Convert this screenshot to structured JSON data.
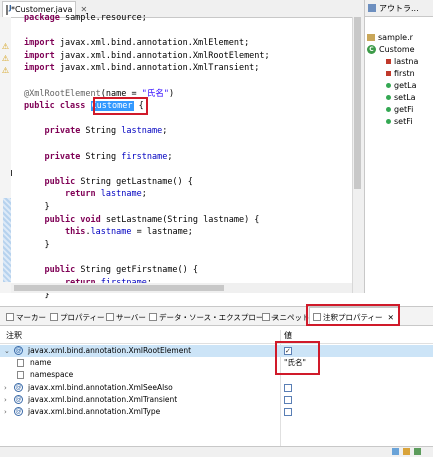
{
  "editor": {
    "tab_label": "*Customer.java",
    "tab_close": "✕",
    "lines": [
      {
        "parts": [
          {
            "c": "kw",
            "t": "package"
          },
          {
            "c": "",
            "t": " sample.resource;"
          }
        ]
      },
      {
        "parts": [
          {
            "c": "",
            "t": ""
          }
        ]
      },
      {
        "parts": [
          {
            "c": "kw",
            "t": "import"
          },
          {
            "c": "",
            "t": " javax.xml.bind.annotation.XmlElement;"
          }
        ]
      },
      {
        "parts": [
          {
            "c": "kw",
            "t": "import"
          },
          {
            "c": "",
            "t": " javax.xml.bind.annotation.XmlRootElement;"
          }
        ]
      },
      {
        "parts": [
          {
            "c": "kw",
            "t": "import"
          },
          {
            "c": "",
            "t": " javax.xml.bind.annotation.XmlTransient;"
          }
        ]
      },
      {
        "parts": [
          {
            "c": "",
            "t": ""
          }
        ]
      },
      {
        "parts": [
          {
            "c": "ann",
            "t": "@XmlRootElement"
          },
          {
            "c": "",
            "t": "(name = "
          },
          {
            "c": "str",
            "t": "\"氏名\""
          },
          {
            "c": "",
            "t": ")"
          }
        ]
      },
      {
        "parts": [
          {
            "c": "kw",
            "t": "public class"
          },
          {
            "c": "",
            "t": " "
          },
          {
            "c": "sel",
            "t": "Customer"
          },
          {
            "c": "",
            "t": " {"
          }
        ]
      },
      {
        "parts": [
          {
            "c": "",
            "t": ""
          }
        ]
      },
      {
        "parts": [
          {
            "c": "",
            "t": "    "
          },
          {
            "c": "kw",
            "t": "private"
          },
          {
            "c": "",
            "t": " String "
          },
          {
            "c": "fld",
            "t": "lastname"
          },
          {
            "c": "",
            "t": ";"
          }
        ]
      },
      {
        "parts": [
          {
            "c": "",
            "t": ""
          }
        ]
      },
      {
        "parts": [
          {
            "c": "",
            "t": "    "
          },
          {
            "c": "kw",
            "t": "private"
          },
          {
            "c": "",
            "t": " String "
          },
          {
            "c": "fld",
            "t": "firstname"
          },
          {
            "c": "",
            "t": ";"
          }
        ]
      },
      {
        "parts": [
          {
            "c": "",
            "t": ""
          }
        ]
      },
      {
        "parts": [
          {
            "c": "",
            "t": "    "
          },
          {
            "c": "kw",
            "t": "public"
          },
          {
            "c": "",
            "t": " String getLastname() {"
          }
        ]
      },
      {
        "parts": [
          {
            "c": "",
            "t": "        "
          },
          {
            "c": "kw",
            "t": "return"
          },
          {
            "c": "",
            "t": " "
          },
          {
            "c": "fld",
            "t": "lastname"
          },
          {
            "c": "",
            "t": ";"
          }
        ]
      },
      {
        "parts": [
          {
            "c": "",
            "t": "    }"
          }
        ]
      },
      {
        "parts": [
          {
            "c": "",
            "t": "    "
          },
          {
            "c": "kw",
            "t": "public void"
          },
          {
            "c": "",
            "t": " setLastname(String lastname) {"
          }
        ]
      },
      {
        "parts": [
          {
            "c": "",
            "t": "        "
          },
          {
            "c": "kw",
            "t": "this"
          },
          {
            "c": "",
            "t": "."
          },
          {
            "c": "fld",
            "t": "lastname"
          },
          {
            "c": "",
            "t": " = lastname;"
          }
        ]
      },
      {
        "parts": [
          {
            "c": "",
            "t": "    }"
          }
        ]
      },
      {
        "parts": [
          {
            "c": "",
            "t": ""
          }
        ]
      },
      {
        "parts": [
          {
            "c": "",
            "t": "    "
          },
          {
            "c": "kw",
            "t": "public"
          },
          {
            "c": "",
            "t": " String getFirstname() {"
          }
        ]
      },
      {
        "parts": [
          {
            "c": "",
            "t": "        "
          },
          {
            "c": "kw",
            "t": "return"
          },
          {
            "c": "",
            "t": " "
          },
          {
            "c": "fld",
            "t": "firstname"
          },
          {
            "c": "",
            "t": ";"
          }
        ]
      },
      {
        "parts": [
          {
            "c": "",
            "t": "    }"
          }
        ]
      }
    ]
  },
  "outline": {
    "tab_label": "アウトラ...",
    "items": [
      {
        "label": "sample.r",
        "icon": "package-icon"
      },
      {
        "label": "Custome",
        "icon": "class-icon"
      },
      {
        "label": "lastna",
        "icon": "field-icon"
      },
      {
        "label": "firstn",
        "icon": "field-icon"
      },
      {
        "label": "getLa",
        "icon": "method-icon"
      },
      {
        "label": "setLa",
        "icon": "method-icon"
      },
      {
        "label": "getFi",
        "icon": "method-icon"
      },
      {
        "label": "setFi",
        "icon": "method-icon"
      }
    ]
  },
  "bottom_tabs": [
    {
      "label": "マーカー"
    },
    {
      "label": "プロパティー"
    },
    {
      "label": "サーバー"
    },
    {
      "label": "データ・ソース・エクスプローラー"
    },
    {
      "label": "スニペット"
    },
    {
      "label": "注釈プロパティー"
    }
  ],
  "active_tab_close": "✕",
  "properties": {
    "col_annotation": "注釈",
    "col_value": "値",
    "rows": [
      {
        "label": "javax.xml.bind.annotation.XmlRootElement",
        "checked": true,
        "expanded": true
      },
      {
        "label": "name",
        "value": "\"氏名\""
      },
      {
        "label": "namespace",
        "value": ""
      },
      {
        "label": "javax.xml.bind.annotation.XmlSeeAlso",
        "checked": false
      },
      {
        "label": "javax.xml.bind.annotation.XmlTransient",
        "checked": false
      },
      {
        "label": "javax.xml.bind.annotation.XmlType",
        "checked": false
      }
    ]
  }
}
